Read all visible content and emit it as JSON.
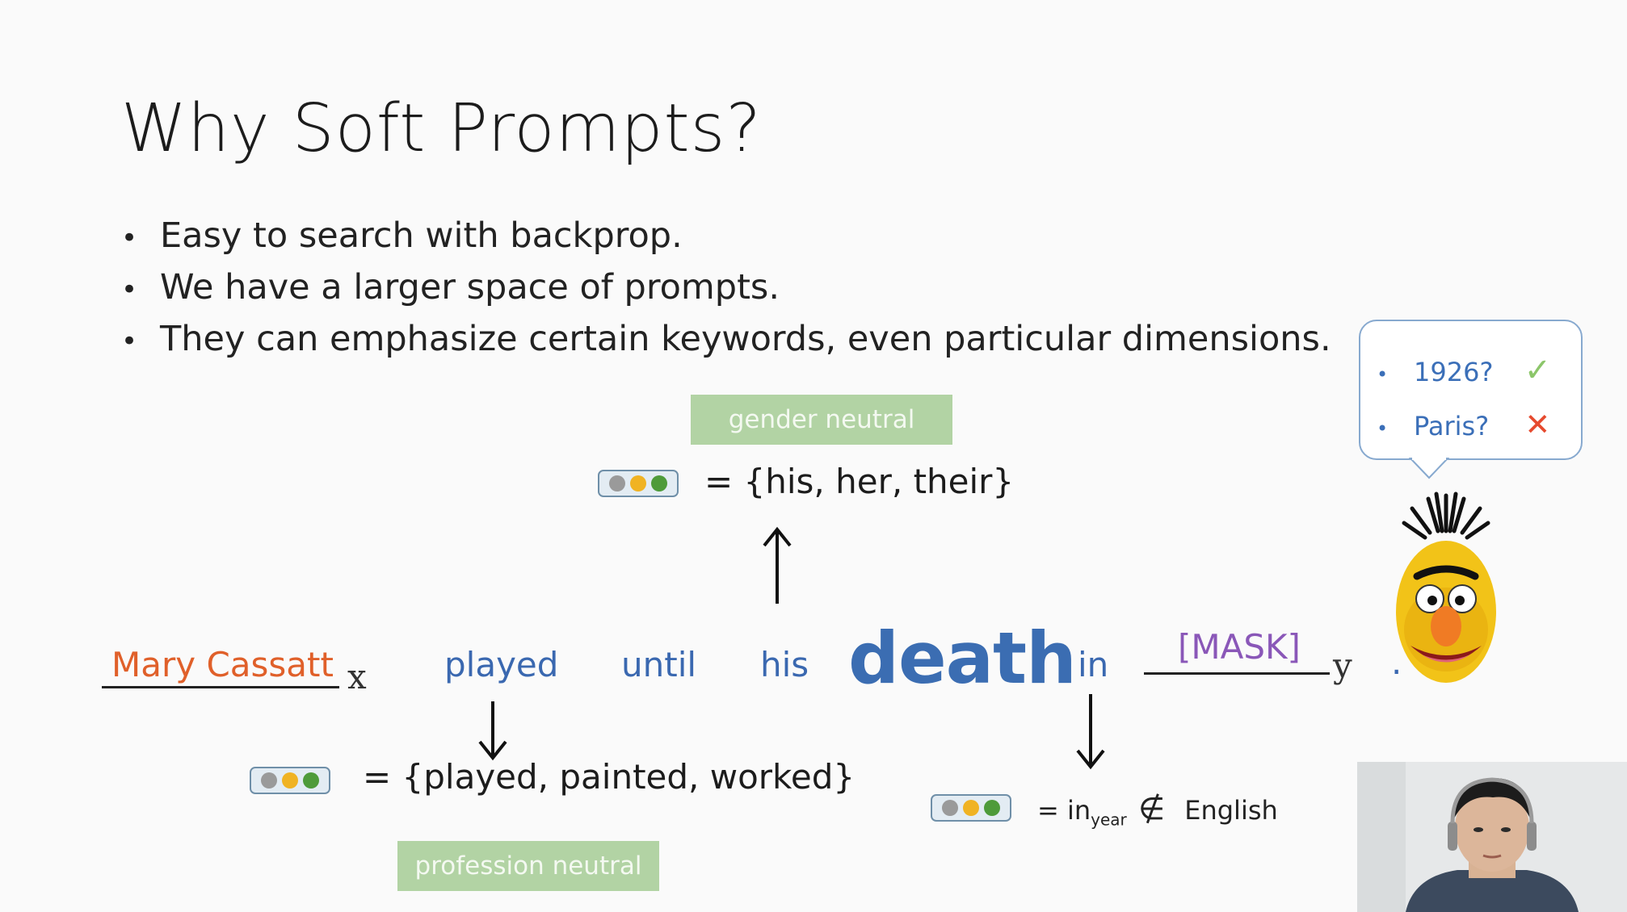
{
  "slide": {
    "title": "Why Soft Prompts?",
    "bullets": [
      "Easy to search with backprop.",
      "We have a larger space of prompts.",
      "They can emphasize certain keywords, even particular dimensions."
    ],
    "bullet_glyph": "•"
  },
  "diagram": {
    "top_tag": "gender neutral",
    "top_set": "= {his, her, their}",
    "bottom_left_tag": "profession neutral",
    "bottom_left_set": "= {played, painted, worked}",
    "bottom_right_eq": "= in",
    "bottom_right_sub": "year",
    "bottom_right_notin": "∉",
    "bottom_right_word": "English",
    "sentence": {
      "subject": "Mary Cassatt",
      "x_var": "x",
      "w1": "played",
      "w2": "until",
      "w3": "his",
      "w4": "death",
      "w5": "in",
      "mask": "[MASK]",
      "y_var": "y",
      "period": "."
    },
    "colors": {
      "subject": "#e0602a",
      "words": "#3a68b0",
      "mask": "#8a57b8",
      "tag_bg": "#b2d3a4",
      "check": "#8cc66a",
      "cross": "#e64a2e"
    }
  },
  "bubble": {
    "items": [
      {
        "text": "1926?",
        "mark": "✓"
      },
      {
        "text": "Paris?",
        "mark": "✕"
      }
    ]
  }
}
